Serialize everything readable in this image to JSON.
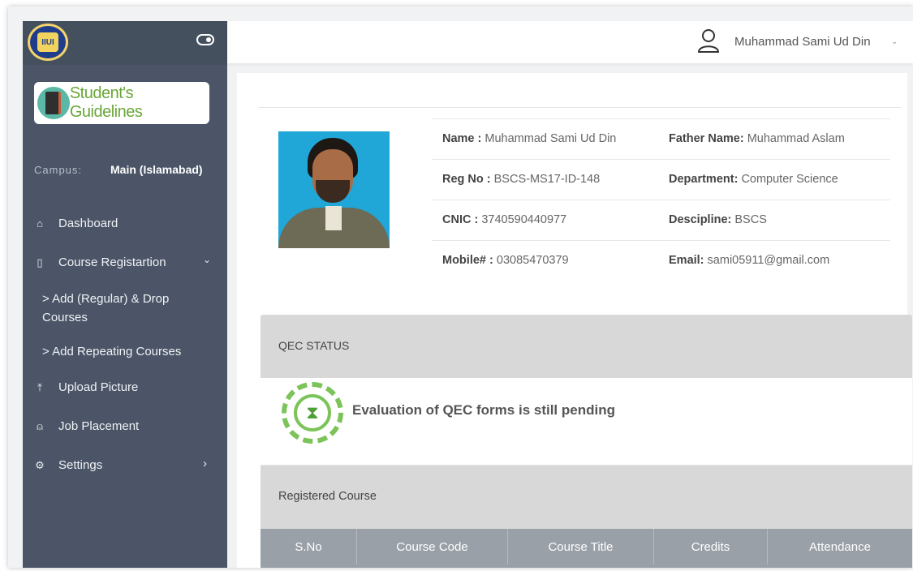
{
  "header": {
    "user_name": "Muhammad Sami Ud Din",
    "user_caret": "⌄"
  },
  "sidebar": {
    "guidelines_label": "Student's Guidelines",
    "campus_label": "Campus:",
    "campus_value": "Main (Islamabad)",
    "items": [
      {
        "label": "Dashboard",
        "icon": "home-icon",
        "glyph": "⌂"
      },
      {
        "label": "Course Registartion",
        "icon": "book-icon",
        "glyph": "▯",
        "caret": "⌄"
      },
      {
        "label": "> Add (Regular) & Drop Courses"
      },
      {
        "label": "> Add Repeating Courses"
      },
      {
        "label": "Upload Picture",
        "icon": "upload-icon",
        "glyph": "⤒"
      },
      {
        "label": "Job Placement",
        "icon": "person-icon",
        "glyph": "⍝"
      },
      {
        "label": "Settings",
        "icon": "gear-icon",
        "glyph": "⚙",
        "caret": "›"
      }
    ]
  },
  "profile": {
    "name_label": "Name :",
    "name_value": "Muhammad Sami Ud Din",
    "father_label": "Father Name:",
    "father_value": "Muhammad Aslam",
    "reg_label": "Reg No :",
    "reg_value": "BSCS-MS17-ID-148",
    "dept_label": "Department:",
    "dept_value": "Computer Science",
    "cnic_label": "CNIC :",
    "cnic_value": "3740590440977",
    "disc_label": "Descipline:",
    "disc_value": "BSCS",
    "mobile_label": "Mobile# :",
    "mobile_value": "03085470379",
    "email_label": "Email:",
    "email_value": "sami05911@gmail.com"
  },
  "qec": {
    "title": "QEC STATUS",
    "message": "Evaluation of QEC forms is still pending"
  },
  "registered": {
    "title": "Registered Course",
    "columns": [
      "S.No",
      "Course Code",
      "Course Title",
      "Credits",
      "Attendance"
    ]
  },
  "colors": {
    "sidebar": "#4b5567",
    "accent_green": "#7cc35a",
    "table_header": "#9aa0a8"
  }
}
